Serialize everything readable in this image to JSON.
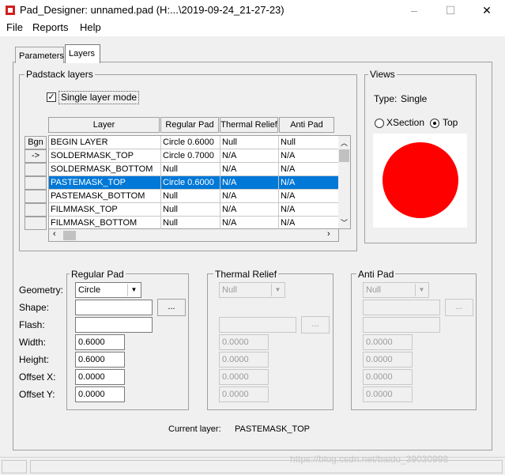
{
  "window": {
    "title": "Pad_Designer: unnamed.pad (H:...\\2019-09-24_21-27-23)",
    "controls": {
      "minimize": "–",
      "maximize": "☐",
      "close": "✕"
    }
  },
  "menu": [
    "File",
    "Reports",
    "Help"
  ],
  "tabs": [
    "Parameters",
    "Layers"
  ],
  "padstack": {
    "group_title": "Padstack layers",
    "single_layer_label": "Single layer mode",
    "single_layer_checked": true,
    "columns": [
      "Layer",
      "Regular Pad",
      "Thermal Relief",
      "Anti Pad"
    ],
    "row_buttons": [
      "Bgn",
      "->",
      "",
      "",
      "",
      "",
      ""
    ],
    "rows": [
      [
        "BEGIN LAYER",
        "Circle 0.6000",
        "Null",
        "Null"
      ],
      [
        "SOLDERMASK_TOP",
        "Circle 0.7000",
        "N/A",
        "N/A"
      ],
      [
        "SOLDERMASK_BOTTOM",
        "Null",
        "N/A",
        "N/A"
      ],
      [
        "PASTEMASK_TOP",
        "Circle 0.6000",
        "N/A",
        "N/A"
      ],
      [
        "PASTEMASK_BOTTOM",
        "Null",
        "N/A",
        "N/A"
      ],
      [
        "FILMMASK_TOP",
        "Null",
        "N/A",
        "N/A"
      ],
      [
        "FILMMASK_BOTTOM",
        "Null",
        "N/A",
        "N/A"
      ]
    ],
    "selected_row": 3
  },
  "views": {
    "group_title": "Views",
    "type_label": "Type:",
    "type_value": "Single",
    "xsection_label": "XSection",
    "top_label": "Top",
    "selected": "Top",
    "preview_color": "#ff0000"
  },
  "labels": {
    "geometry": "Geometry:",
    "shape": "Shape:",
    "flash": "Flash:",
    "width": "Width:",
    "height": "Height:",
    "offset_x": "Offset X:",
    "offset_y": "Offset Y:"
  },
  "regular_pad": {
    "title": "Regular Pad",
    "geometry": "Circle",
    "shape": "",
    "flash": "",
    "width": "0.6000",
    "height": "0.6000",
    "offset_x": "0.0000",
    "offset_y": "0.0000",
    "browse": "..."
  },
  "thermal_relief": {
    "title": "Thermal Relief",
    "geometry": "Null",
    "shape": "",
    "flash": "",
    "width": "0.0000",
    "height": "0.0000",
    "offset_x": "0.0000",
    "offset_y": "0.0000",
    "browse": "..."
  },
  "anti_pad": {
    "title": "Anti Pad",
    "geometry": "Null",
    "shape": "",
    "flash": "",
    "width": "0.0000",
    "height": "0.0000",
    "offset_x": "0.0000",
    "offset_y": "0.0000",
    "browse": "..."
  },
  "current_layer": {
    "label": "Current layer:",
    "value": "PASTEMASK_TOP"
  },
  "watermark": "https://blog.csdn.net/baidu_39030998",
  "colors": {
    "selection": "#0078d7",
    "pad": "#ff0000"
  }
}
